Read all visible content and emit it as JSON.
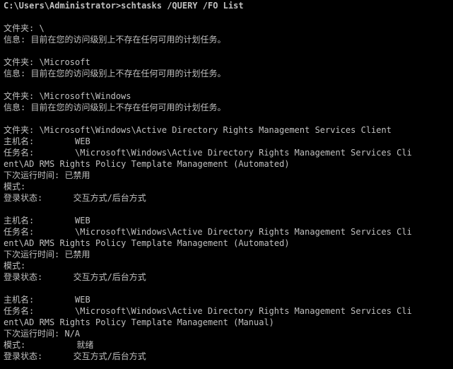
{
  "console": {
    "lines": [
      "C:\\Users\\Administrator>schtasks /QUERY /FO List",
      "",
      "文件夹: \\",
      "信息: 目前在您的访问级别上不存在任何可用的计划任务。",
      "",
      "文件夹: \\Microsoft",
      "信息: 目前在您的访问级别上不存在任何可用的计划任务。",
      "",
      "文件夹: \\Microsoft\\Windows",
      "信息: 目前在您的访问级别上不存在任何可用的计划任务。",
      "",
      "文件夹: \\Microsoft\\Windows\\Active Directory Rights Management Services Client",
      "主机名:        WEB",
      "任务名:        \\Microsoft\\Windows\\Active Directory Rights Management Services Cli",
      "ent\\AD RMS Rights Policy Template Management (Automated)",
      "下次运行时间: 已禁用",
      "模式:",
      "登录状态:      交互方式/后台方式",
      "",
      "主机名:        WEB",
      "任务名:        \\Microsoft\\Windows\\Active Directory Rights Management Services Cli",
      "ent\\AD RMS Rights Policy Template Management (Automated)",
      "下次运行时间: 已禁用",
      "模式:",
      "登录状态:      交互方式/后台方式",
      "",
      "主机名:        WEB",
      "任务名:        \\Microsoft\\Windows\\Active Directory Rights Management Services Cli",
      "ent\\AD RMS Rights Policy Template Management (Manual)",
      "下次运行时间: N/A",
      "模式:          就绪",
      "登录状态:      交互方式/后台方式"
    ]
  }
}
